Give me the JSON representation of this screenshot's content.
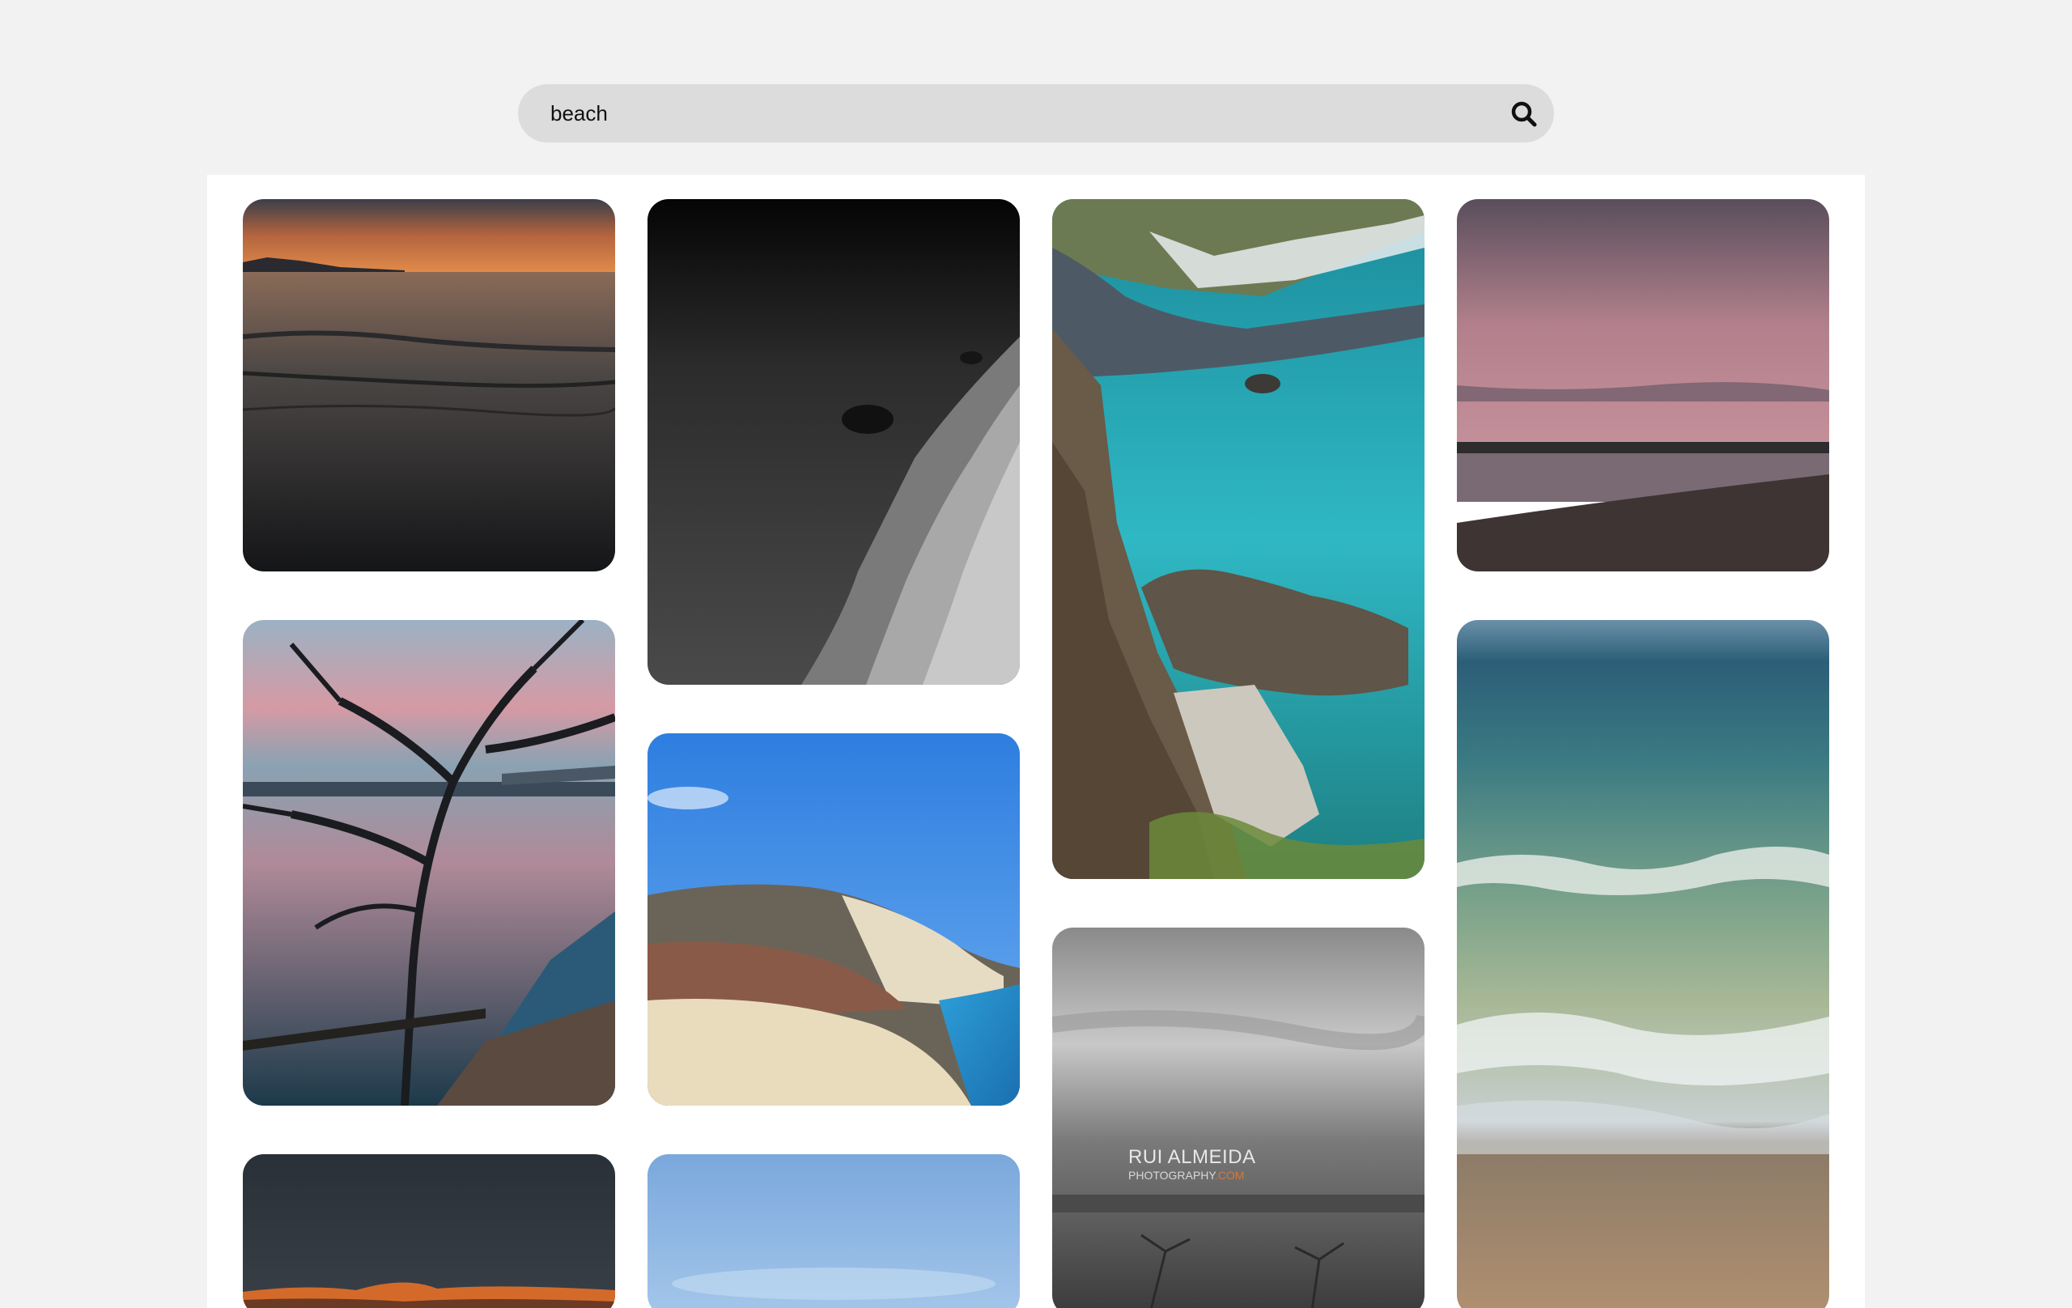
{
  "search": {
    "value": "beach",
    "icon": "search-icon"
  },
  "gallery": {
    "images": [
      {
        "name": "sunset-calm-sea-photo"
      },
      {
        "name": "black-white-shoreline-photo"
      },
      {
        "name": "turquoise-cove-cliffs-photo"
      },
      {
        "name": "pink-sky-beach-photo"
      },
      {
        "name": "tree-over-lake-sunset-photo"
      },
      {
        "name": "sand-dunes-blue-sky-photo"
      },
      {
        "name": "grey-seascape-photo"
      },
      {
        "name": "ocean-waves-shore-photo"
      },
      {
        "name": "dark-sky-fire-horizon-photo"
      },
      {
        "name": "light-blue-sky-photo"
      }
    ],
    "watermark": {
      "line1": "RUI ALMEIDA",
      "line2_prefix": "PHOTOGRAPHY",
      "line2_suffix": ".COM",
      "accent_color": "#d2783c"
    }
  }
}
